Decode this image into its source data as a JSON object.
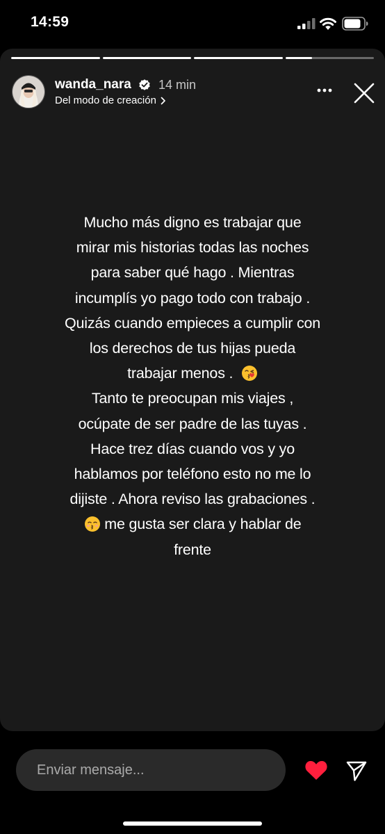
{
  "status_bar": {
    "time": "14:59"
  },
  "story": {
    "progress": [
      1,
      1,
      1,
      0.3
    ],
    "username": "wanda_nara",
    "timestamp": "14 min",
    "subtitle": "Del modo de creación",
    "text_lines": [
      "Mucho más digno es trabajar que",
      "mirar mis historias todas las noches",
      "para saber qué hago .  Mientras",
      "incumplís yo pago todo con trabajo .",
      "Quizás cuando empieces a cumplir con",
      "los derechos de tus hijas pueda",
      "trabajar menos .",
      "Tanto te preocupan mis viajes ,",
      "ocúpate de  ser padre de las tuyas .",
      "Hace trez días cuando vos y yo",
      "hablamos por teléfono  esto no me lo",
      "dijiste . Ahora reviso las grabaciones .",
      "me gusta ser clara y hablar de",
      "frente"
    ]
  },
  "message_bar": {
    "placeholder": "Enviar mensaje..."
  },
  "colors": {
    "background": "#000000",
    "card": "#1a1a1a",
    "heart": "#ff1f3d"
  }
}
